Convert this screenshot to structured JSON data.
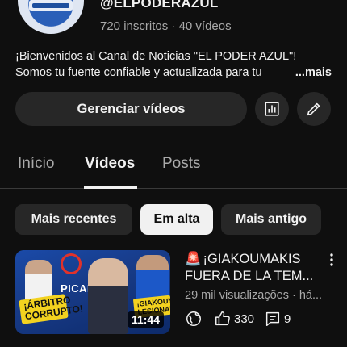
{
  "channel": {
    "handle": "@ELPODERAZUL",
    "subscribers": "720 inscritos",
    "separator": "·",
    "videos_count": "40 vídeos",
    "avatar_icon": "channel-logo"
  },
  "description": {
    "line1": "¡Bienvenidos al Canal de Noticias \"EL PODER AZUL\"!",
    "line2": "Somos tu fuente confiable y actualizada para tu",
    "more": "...mais"
  },
  "actions": {
    "manage_videos": "Gerenciar vídeos",
    "analytics_icon": "analytics-icon",
    "edit_icon": "pencil-icon"
  },
  "tabs": [
    {
      "label": "Início",
      "active": false
    },
    {
      "label": "Vídeos",
      "active": true
    },
    {
      "label": "Posts",
      "active": false
    }
  ],
  "chips": [
    {
      "label": "Mais recentes",
      "selected": false
    },
    {
      "label": "Em alta",
      "selected": true
    },
    {
      "label": "Mais antigo",
      "selected": false
    }
  ],
  "video": {
    "title_line1": "¡GIAKOUMAKIS",
    "title_line2": "FUERA DE LA TEM...",
    "siren_icon": "siren-emoji",
    "views": "29 mil visualizações · há...",
    "duration": "11:44",
    "thumb_text_left": "¡ÁRBITRO CORRUPTO!",
    "thumb_text_right": "¡GIAKOUMAKIS LESIONADO!",
    "thumb_text_center": "PICANTE",
    "visibility_icon": "globe-icon",
    "likes": "330",
    "comments": "9",
    "like_icon": "thumbs-up-icon",
    "comment_icon": "comment-icon",
    "menu_icon": "more-vert-icon"
  }
}
